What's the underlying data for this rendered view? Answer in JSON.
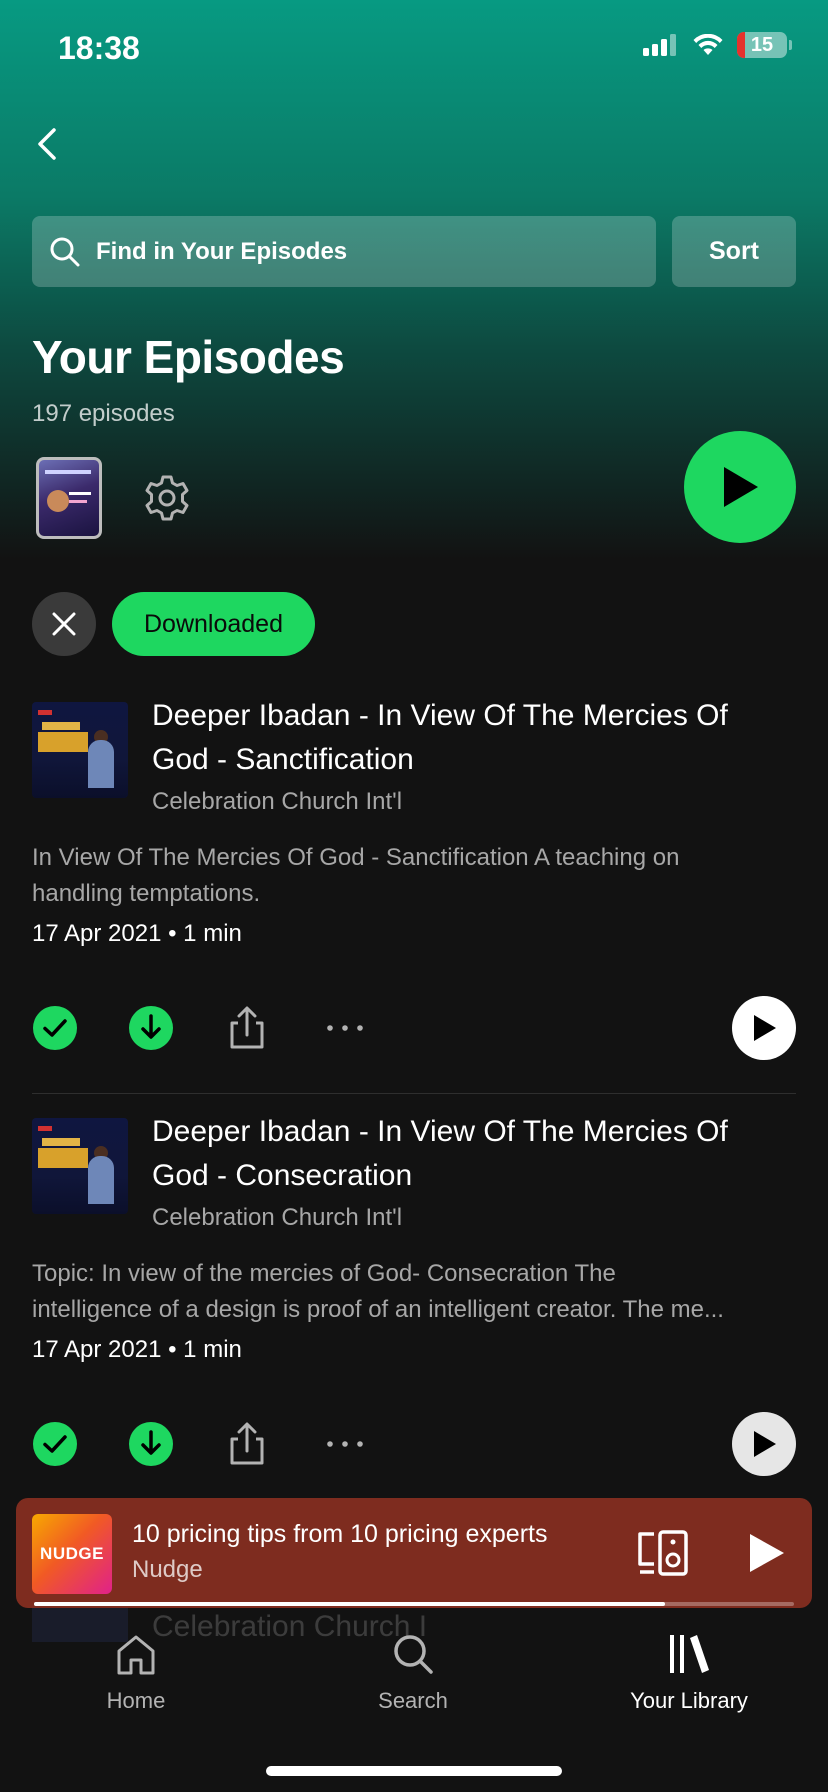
{
  "status_bar": {
    "time": "18:38",
    "battery": "15"
  },
  "search": {
    "placeholder": "Find in Your Episodes"
  },
  "sort_label": "Sort",
  "page_title": "Your Episodes",
  "episode_count": "197 episodes",
  "filter_chip": "Downloaded",
  "episodes": [
    {
      "title": "Deeper Ibadan - In View Of The Mercies Of God - Sanctification",
      "show": "Celebration Church Int'l",
      "description_lines": [
        "In View Of The Mercies Of God - Sanctification A teaching on",
        "handling temptations."
      ],
      "meta": "17 Apr 2021 • 1 min"
    },
    {
      "title": "Deeper Ibadan - In View Of The Mercies Of God - Consecration",
      "show": "Celebration Church Int'l",
      "description_lines": [
        "Topic: In view of the mercies of God- Consecration  The",
        "intelligence of a design is proof of an intelligent creator. The me..."
      ],
      "meta": "17 Apr 2021 • 1 min"
    }
  ],
  "ghost_row_text": "Celebration Church I",
  "now_playing": {
    "art_label": "NUDGE",
    "title": "10 pricing tips from 10 pricing experts",
    "show": "Nudge",
    "progress": 0.83
  },
  "nav": {
    "home": "Home",
    "search": "Search",
    "library": "Your Library"
  },
  "colors": {
    "accent": "#1ed760",
    "header_gradient_top": "#079a82",
    "background": "#121212",
    "mini_player": "#7e2c1f"
  }
}
